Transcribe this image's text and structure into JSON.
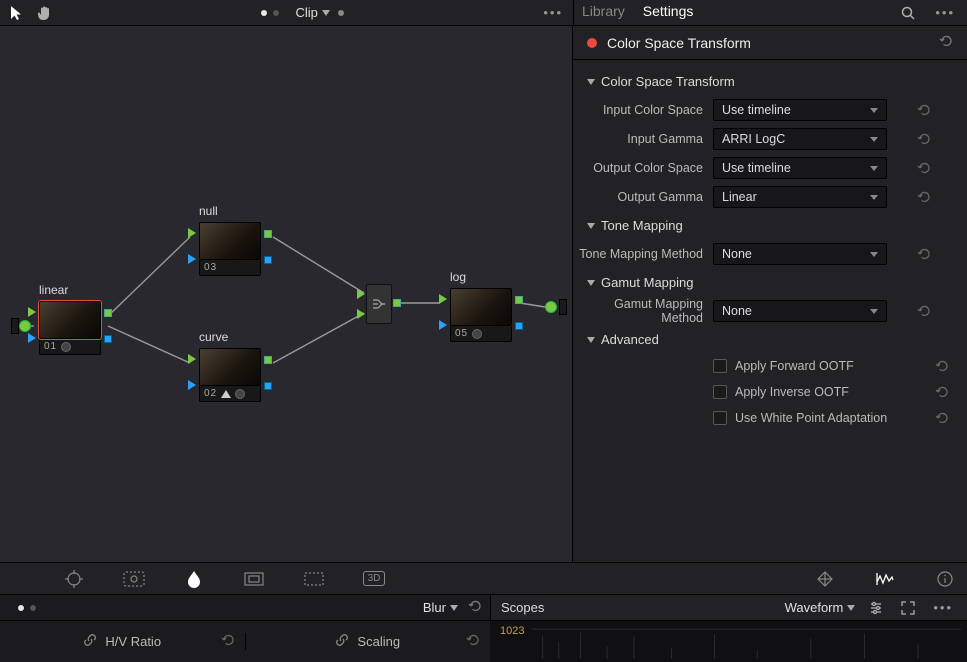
{
  "top": {
    "clip_label": "Clip",
    "tabs": {
      "library": "Library",
      "settings": "Settings"
    }
  },
  "nodes": {
    "linear": {
      "label": "linear",
      "num": "01"
    },
    "null": {
      "label": "null",
      "num": "03"
    },
    "curve": {
      "label": "curve",
      "num": "02"
    },
    "log": {
      "label": "log",
      "num": "05"
    }
  },
  "panel": {
    "title": "Color Space Transform",
    "sections": {
      "cst": "Color Space Transform",
      "tone": "Tone Mapping",
      "gamut": "Gamut Mapping",
      "adv": "Advanced"
    },
    "fields": {
      "in_cs": {
        "label": "Input Color Space",
        "value": "Use timeline"
      },
      "in_g": {
        "label": "Input Gamma",
        "value": "ARRI LogC"
      },
      "out_cs": {
        "label": "Output Color Space",
        "value": "Use timeline"
      },
      "out_g": {
        "label": "Output Gamma",
        "value": "Linear"
      },
      "tm": {
        "label": "Tone Mapping Method",
        "value": "None"
      },
      "gm": {
        "label": "Gamut Mapping Method",
        "value": "None"
      }
    },
    "checks": {
      "fwd": "Apply Forward OOTF",
      "inv": "Apply Inverse OOTF",
      "wpa": "Use White Point Adaptation"
    }
  },
  "lower": {
    "blur_label": "Blur",
    "scopes_label": "Scopes",
    "waveform_label": "Waveform",
    "hv_ratio": "H/V Ratio",
    "scaling": "Scaling",
    "wf_value": "1023"
  },
  "tool_strip": {
    "threed": "3D"
  }
}
